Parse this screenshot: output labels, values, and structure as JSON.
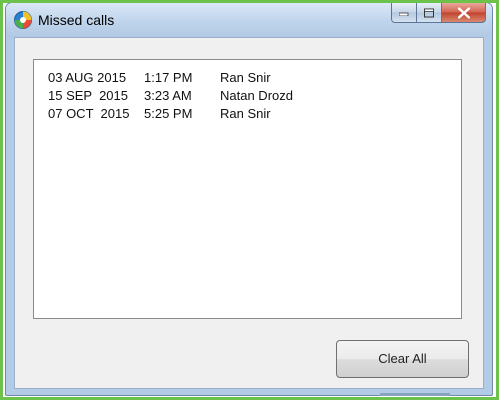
{
  "window": {
    "title": "Missed calls",
    "controls": [
      "minimize-icon",
      "maximize-icon",
      "close-icon"
    ]
  },
  "missed_calls": [
    {
      "date": "03 AUG 2015",
      "time": "1:17 PM",
      "name": "Ran Snir"
    },
    {
      "date": "15 SEP  2015",
      "time": "3:23 AM",
      "name": "Natan Drozd"
    },
    {
      "date": "07 OCT  2015",
      "time": "5:25 PM",
      "name": "Ran Snir"
    }
  ],
  "actions": {
    "clear_all_label": "Clear All"
  },
  "colors": {
    "outline_green": "#6cc24a",
    "titlebar": "#bfd4ec",
    "client_bg": "#f0f0f0",
    "close_red": "#c0422d"
  }
}
